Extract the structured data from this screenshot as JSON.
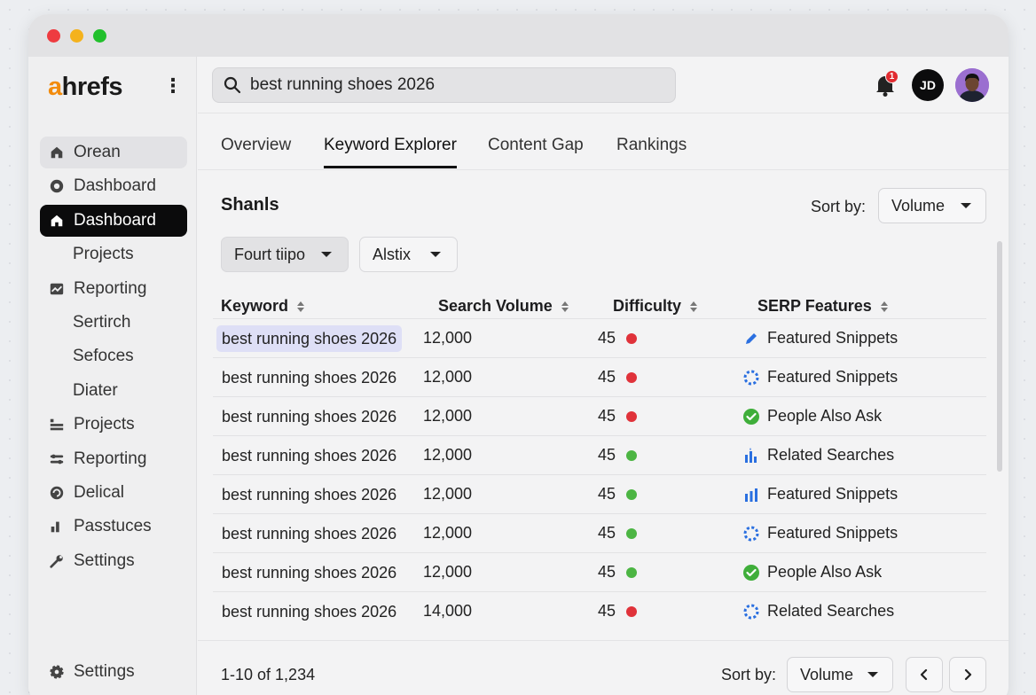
{
  "app": {
    "logo_a": "a",
    "logo_rest": "hrefs"
  },
  "sidebar": {
    "items": [
      {
        "label": "Orean",
        "icon": "home-icon"
      },
      {
        "label": "Dashboard",
        "icon": "eye-icon"
      },
      {
        "label": "Dashboard",
        "icon": "home-icon"
      },
      {
        "label": "Projects",
        "icon": ""
      },
      {
        "label": "Reporting",
        "icon": "chart-box-icon"
      },
      {
        "label": "Sertirch",
        "icon": ""
      },
      {
        "label": "Sefoces",
        "icon": ""
      },
      {
        "label": "Diater",
        "icon": ""
      },
      {
        "label": "Projects",
        "icon": "projects-icon"
      },
      {
        "label": "Reporting",
        "icon": "sliders-icon"
      },
      {
        "label": "Delical",
        "icon": "refresh-icon"
      },
      {
        "label": "Passtuces",
        "icon": "bar-chart-icon"
      },
      {
        "label": "Settings",
        "icon": "wrench-icon"
      }
    ],
    "bottom_settings": "Settings"
  },
  "search": {
    "value": "best running shoes 2026"
  },
  "notifications": {
    "count": "1"
  },
  "user": {
    "initials": "JD"
  },
  "tabs": [
    "Overview",
    "Keyword Explorer",
    "Content Gap",
    "Rankings"
  ],
  "section": {
    "title": "Shanls",
    "sort_label": "Sort by:",
    "sort_value": "Volume",
    "filters": [
      "Fourt tiipo",
      "Alstix"
    ]
  },
  "table": {
    "headers": [
      "Keyword",
      "Search Volume",
      "Difficulty",
      "SERP Features"
    ],
    "rows": [
      {
        "keyword": "best running shoes 2026",
        "volume": "12,000",
        "difficulty": "45",
        "dot": "#e0323a",
        "feature": "Featured Snippets",
        "feature_icon": "pencil-icon"
      },
      {
        "keyword": "best running shoes 2026",
        "volume": "12,000",
        "difficulty": "45",
        "dot": "#e0323a",
        "feature": "Featured Snippets",
        "feature_icon": "dotted-circle-icon"
      },
      {
        "keyword": "best running shoes 2026",
        "volume": "12,000",
        "difficulty": "45",
        "dot": "#e0323a",
        "feature": "People Also Ask",
        "feature_icon": "check-circle-icon"
      },
      {
        "keyword": "best running shoes 2026",
        "volume": "12,000",
        "difficulty": "45",
        "dot": "#4cb543",
        "feature": "Related Searches",
        "feature_icon": "bars-sparkle-icon"
      },
      {
        "keyword": "best running shoes 2026",
        "volume": "12,000",
        "difficulty": "45",
        "dot": "#4cb543",
        "feature": "Featured Snippets",
        "feature_icon": "bars-icon"
      },
      {
        "keyword": "best running shoes 2026",
        "volume": "12,000",
        "difficulty": "45",
        "dot": "#4cb543",
        "feature": "Featured Snippets",
        "feature_icon": "dotted-circle-icon"
      },
      {
        "keyword": "best running shoes 2026",
        "volume": "12,000",
        "difficulty": "45",
        "dot": "#4cb543",
        "feature": "People Also Ask",
        "feature_icon": "check-circle-icon"
      },
      {
        "keyword": "best running shoes 2026",
        "volume": "14,000",
        "difficulty": "45",
        "dot": "#e0323a",
        "feature": "Related Searches",
        "feature_icon": "dotted-circle-icon"
      }
    ]
  },
  "footer": {
    "range_text": "1-10 of 1,234",
    "sort_label": "Sort by:",
    "sort_value": "Volume"
  },
  "colors": {
    "accent": "#f28b0c",
    "active_nav": "#0b0b0c",
    "badge": "#e12b30",
    "difficulty_high": "#e0323a",
    "difficulty_low": "#4cb543",
    "serp_blue": "#2a6fe0"
  }
}
